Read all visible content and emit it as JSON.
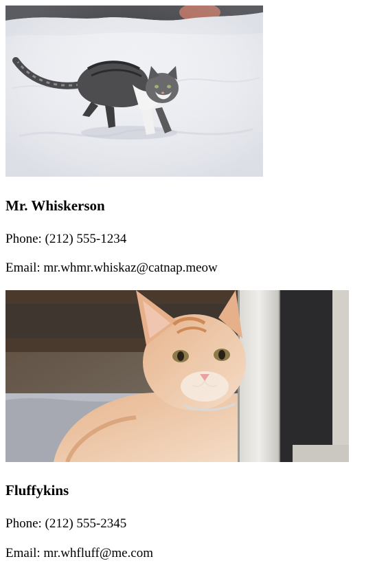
{
  "contacts": [
    {
      "image_alt": "Tabby kitten walking in snow",
      "name": "Mr. Whiskerson",
      "phone_label": "Phone:",
      "phone": "(212) 555-1234",
      "email_label": "Email:",
      "email": "mr.whmr.whiskaz@catnap.meow"
    },
    {
      "image_alt": "Orange and white kitten beside a wooden post",
      "name": "Fluffykins",
      "phone_label": "Phone:",
      "phone": "(212) 555-2345",
      "email_label": "Email:",
      "email": "mr.whfluff@me.com"
    }
  ]
}
